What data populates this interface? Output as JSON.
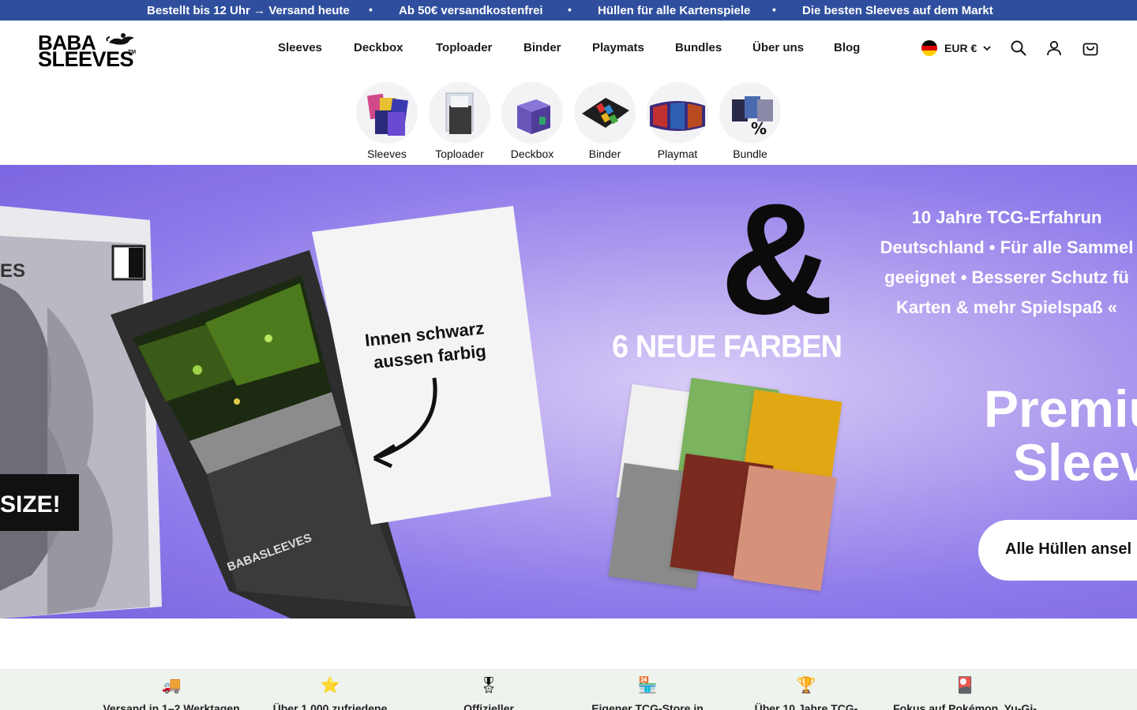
{
  "announcement": {
    "messages": [
      "Bestellt bis 12 Uhr → Versand heute",
      "Ab 50€ versandkostenfrei",
      "Hüllen für alle Kartenspiele",
      "Die besten Sleeves auf dem Markt"
    ],
    "separator": "•"
  },
  "brand": {
    "line1": "BABA",
    "line2": "SLEEVES",
    "tm": "TM"
  },
  "nav": {
    "items": [
      "Sleeves",
      "Deckbox",
      "Toploader",
      "Binder",
      "Playmats",
      "Bundles",
      "Über uns",
      "Blog"
    ]
  },
  "header": {
    "currency_label": "EUR €",
    "icons": [
      "search-icon",
      "account-icon",
      "cart-icon"
    ]
  },
  "categories": {
    "items": [
      {
        "label": "Sleeves",
        "icon": "sleeves-thumbnail"
      },
      {
        "label": "Toploader",
        "icon": "toploader-thumbnail"
      },
      {
        "label": "Deckbox",
        "icon": "deckbox-thumbnail"
      },
      {
        "label": "Binder",
        "icon": "binder-thumbnail"
      },
      {
        "label": "Playmat",
        "icon": "playmat-thumbnail"
      },
      {
        "label": "Bundle",
        "icon": "bundle-thumbnail"
      }
    ]
  },
  "hero": {
    "tagline_lines": [
      "10 Jahre TCG-Erfahrun",
      "Deutschland • Für alle Sammel",
      "geeignet • Besserer Schutz fü",
      "Karten & mehr Spielspaß «"
    ],
    "title_line1": "Premiu",
    "title_line2": "Sleev",
    "cta_label": "Alle Hüllen ansel",
    "image_texts": {
      "amp": "&",
      "new_colors": "6 NEUE FARBEN",
      "card_text": "Innen schwarz aussen farbig",
      "box_brand": "BABASLEEVES",
      "box_partial": "ES",
      "size_partial": "SIZE!"
    },
    "swatch_colors": [
      "#f0f0f0",
      "#7bb35e",
      "#e2a814",
      "#8a8a8a",
      "#7a2a1e",
      "#d6917a"
    ],
    "background_color": "#8f7bea"
  },
  "features": {
    "items": [
      {
        "icon": "🚚",
        "text": "Versand in 1–2 Werktagen"
      },
      {
        "icon": "⭐",
        "text": "Über 1.000 zufriedene"
      },
      {
        "icon": "🎖",
        "text": "Offizieller"
      },
      {
        "icon": "🏪",
        "text": "Eigener TCG-Store in"
      },
      {
        "icon": "🏆",
        "text": "Über 10 Jahre TCG-"
      },
      {
        "icon": "🎴",
        "text": "Fokus auf Pokémon, Yu-Gi-"
      }
    ]
  },
  "colors": {
    "announcement_bg": "#2f4f9e",
    "features_bg": "#eef3ee",
    "flag": [
      "#000000",
      "#dd0000",
      "#ffce00"
    ]
  }
}
